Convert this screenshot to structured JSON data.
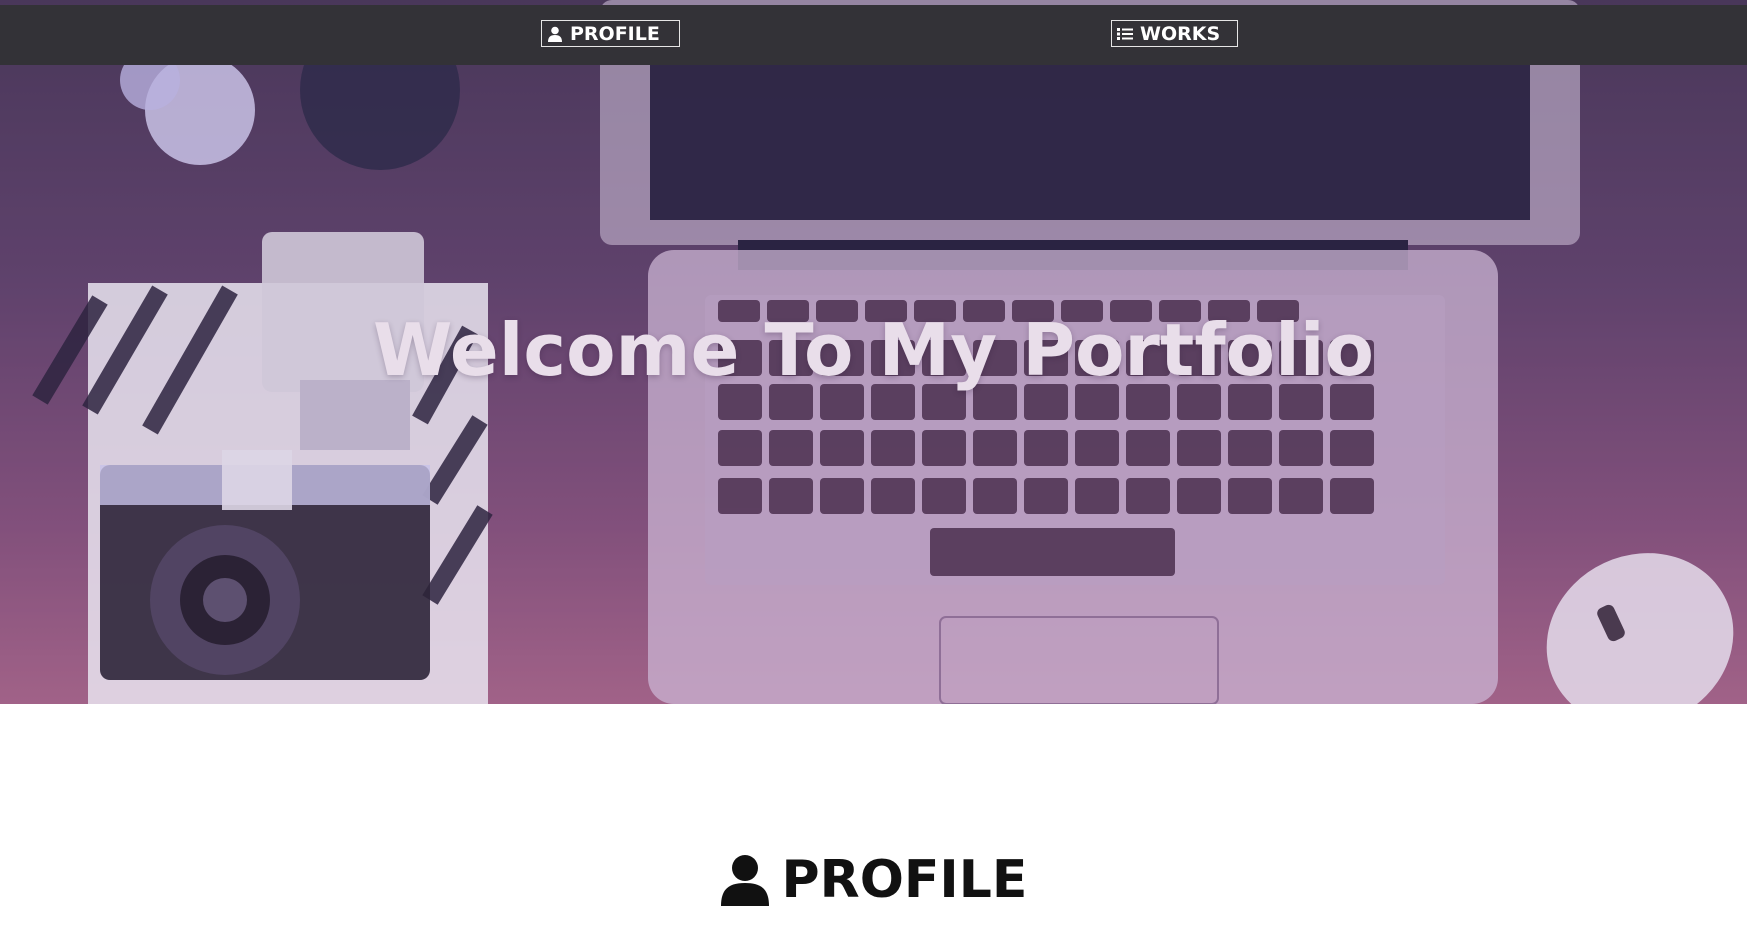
{
  "nav": {
    "profile_label": "PROFILE",
    "works_label": "WORKS",
    "profile_icon": "user-icon",
    "works_icon": "list-icon"
  },
  "hero": {
    "title": "Welcome To My Portfolio"
  },
  "profile_section": {
    "title": "PROFILE",
    "icon": "user-icon"
  },
  "colors": {
    "nav_bar": "#333237",
    "hero_overlay_top": "#3e3153",
    "hero_overlay_bottom": "#b36a90",
    "hero_text": "#e9deea",
    "section_text": "#111111"
  }
}
